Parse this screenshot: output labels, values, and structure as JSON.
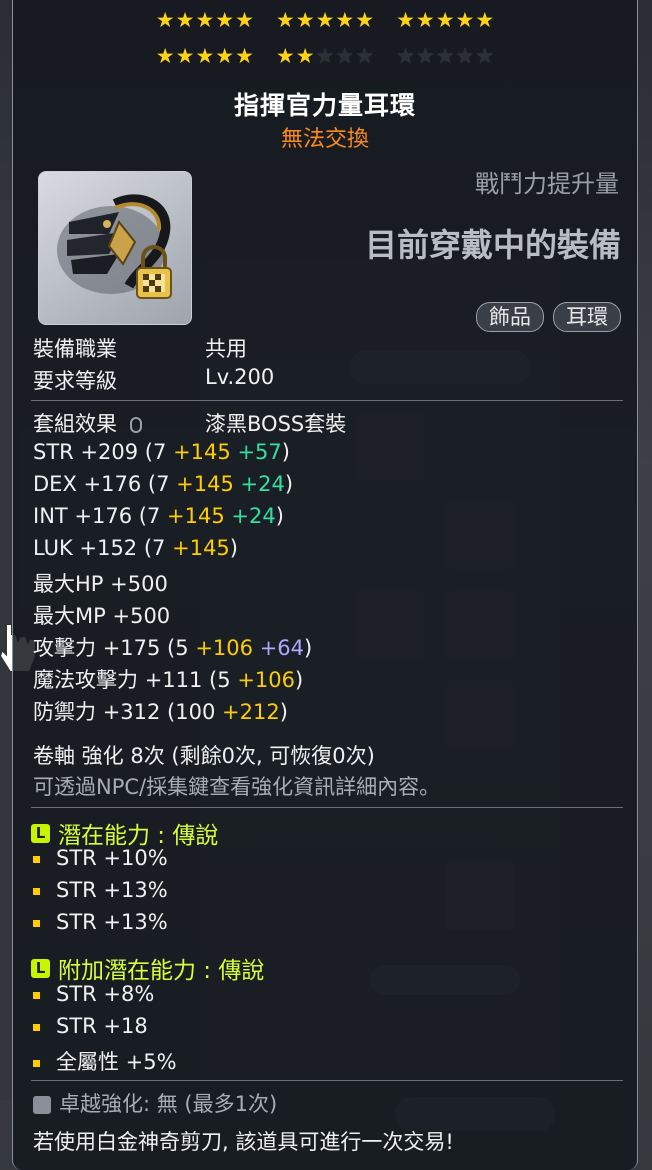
{
  "stars": {
    "row1": [
      5,
      5,
      5
    ],
    "row2": [
      5,
      2,
      0
    ],
    "filled_total": 22,
    "max_total": 30,
    "colors": {
      "filled": "#ffd21a",
      "empty": "#2b2f36"
    }
  },
  "item": {
    "name": "指揮官力量耳環",
    "trade_status": "無法交換",
    "icon": "earring-icon",
    "lock_icon": "padlock-icon"
  },
  "header": {
    "power_label": "戰鬥力提升量",
    "equipped_text": "目前穿戴中的裝備",
    "tags": [
      "飾品",
      "耳環"
    ]
  },
  "requirements": {
    "job_label": "裝備職業",
    "job_value": "共用",
    "level_label": "要求等級",
    "level_value": "Lv.200"
  },
  "set_effect": {
    "label": "套組效果",
    "value": "漆黑BOSS套裝"
  },
  "stats": [
    {
      "name": "STR",
      "total": "+209",
      "base": "7",
      "bonus": "+145",
      "extra": "+57",
      "extra_color": "green"
    },
    {
      "name": "DEX",
      "total": "+176",
      "base": "7",
      "bonus": "+145",
      "extra": "+24",
      "extra_color": "green"
    },
    {
      "name": "INT",
      "total": "+176",
      "base": "7",
      "bonus": "+145",
      "extra": "+24",
      "extra_color": "green"
    },
    {
      "name": "LUK",
      "total": "+152",
      "base": "7",
      "bonus": "+145",
      "extra": "",
      "extra_color": ""
    },
    {
      "name": "最大HP",
      "total": "+500"
    },
    {
      "name": "最大MP",
      "total": "+500"
    },
    {
      "name": "攻擊力",
      "total": "+175",
      "base": "5",
      "bonus": "+106",
      "extra": "+64",
      "extra_color": "purple"
    },
    {
      "name": "魔法攻擊力",
      "total": "+111",
      "base": "5",
      "bonus": "+106",
      "extra": "",
      "extra_color": ""
    },
    {
      "name": "防禦力",
      "total": "+312",
      "base": "100",
      "bonus": "+212",
      "extra": "",
      "extra_color": ""
    }
  ],
  "upgrade": {
    "scroll_line": "卷軸 強化 8次 (剩餘0次, 可恢復0次)",
    "hint": "可透過NPC/採集鍵查看強化資訊詳細內容。"
  },
  "potential": {
    "badge": "L",
    "title": "潛在能力 : 傳說",
    "lines": [
      "STR +10%",
      "STR +13%",
      "STR +13%"
    ]
  },
  "additional_potential": {
    "badge": "L",
    "title": "附加潛在能力 : 傳說",
    "lines": [
      "STR +8%",
      "STR +18",
      "全屬性 +5%"
    ]
  },
  "bottom": {
    "star_force": "卓越強化:  無 (最多1次)",
    "trade_hint": "若使用白金神奇剪刀, 該道具可進行一次交易!"
  },
  "colors": {
    "trade": "#ff8a1c",
    "bonus_yellow": "#ffcc00",
    "extra_green": "#33e0a0",
    "extra_purple": "#b0a8ff",
    "potential_title": "#d6ff3a"
  }
}
